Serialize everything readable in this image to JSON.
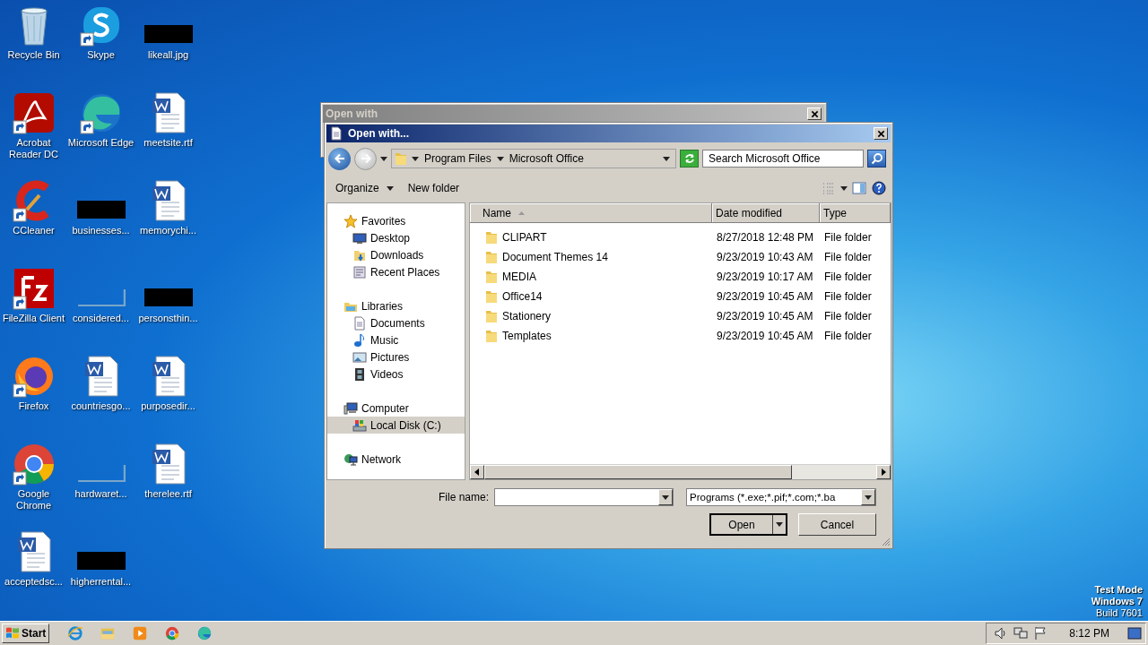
{
  "desktop_icons": [
    {
      "label": "Recycle Bin",
      "kind": "recycle",
      "shortcut": false
    },
    {
      "label": "Acrobat Reader DC",
      "kind": "acrobat",
      "shortcut": true
    },
    {
      "label": "CCleaner",
      "kind": "ccleaner",
      "shortcut": true
    },
    {
      "label": "FileZilla Client",
      "kind": "filezilla",
      "shortcut": true
    },
    {
      "label": "Firefox",
      "kind": "firefox",
      "shortcut": true
    },
    {
      "label": "Google Chrome",
      "kind": "chrome",
      "shortcut": true
    },
    {
      "label": "acceptedsc...",
      "kind": "word",
      "shortcut": false
    },
    {
      "label": "Skype",
      "kind": "skype",
      "shortcut": true
    },
    {
      "label": "Microsoft Edge",
      "kind": "edge",
      "shortcut": true
    },
    {
      "label": "businesses...",
      "kind": "redacted"
    },
    {
      "label": "considered...",
      "kind": "blank"
    },
    {
      "label": "countriesgo...",
      "kind": "word",
      "shortcut": false
    },
    {
      "label": "hardwaret...",
      "kind": "blank"
    },
    {
      "label": "higherrental...",
      "kind": "redacted"
    },
    {
      "label": "likeall.jpg",
      "kind": "redacted"
    },
    {
      "label": "meetsite.rtf",
      "kind": "word",
      "shortcut": false
    },
    {
      "label": "memorychi...",
      "kind": "word",
      "shortcut": false
    },
    {
      "label": "personsthin...",
      "kind": "redacted"
    },
    {
      "label": "purposedir...",
      "kind": "word",
      "shortcut": false
    },
    {
      "label": "therelee.rtf",
      "kind": "word",
      "shortcut": false
    }
  ],
  "desktop_notice": [
    "Test Mode",
    "Windows 7",
    "Build 7601"
  ],
  "back_window": {
    "title": "Open with"
  },
  "dialog": {
    "title": "Open with...",
    "breadcrumb": [
      "Program Files",
      "Microsoft Office"
    ],
    "search": {
      "placeholder": "Search Microsoft Office"
    },
    "toolbar": [
      "Organize",
      "New folder"
    ],
    "nav": [
      {
        "label": "Favorites",
        "kind": "star",
        "selected": false,
        "children": [
          {
            "label": "Desktop",
            "kind": "desktop",
            "selected": false
          },
          {
            "label": "Downloads",
            "kind": "downloads",
            "selected": false
          },
          {
            "label": "Recent Places",
            "kind": "recent",
            "selected": false
          }
        ]
      },
      {
        "label": "Libraries",
        "kind": "library",
        "selected": false,
        "children": [
          {
            "label": "Documents",
            "kind": "documents",
            "selected": false
          },
          {
            "label": "Music",
            "kind": "music",
            "selected": false
          },
          {
            "label": "Pictures",
            "kind": "pictures",
            "selected": false
          },
          {
            "label": "Videos",
            "kind": "videos",
            "selected": false
          }
        ]
      },
      {
        "label": "Computer",
        "kind": "computer",
        "selected": false,
        "children": [
          {
            "label": "Local Disk (C:)",
            "kind": "drive",
            "selected": true
          }
        ]
      },
      {
        "label": "Network",
        "kind": "network",
        "selected": false
      }
    ],
    "columns": [
      {
        "label": "Name",
        "sorted": true
      },
      {
        "label": "Date modified",
        "sorted": false
      },
      {
        "label": "Type",
        "sorted": false
      }
    ],
    "rows": [
      {
        "name": "CLIPART",
        "date": "8/27/2018 12:48 PM",
        "type": "File folder"
      },
      {
        "name": "Document Themes 14",
        "date": "9/23/2019 10:43 AM",
        "type": "File folder"
      },
      {
        "name": "MEDIA",
        "date": "9/23/2019 10:17 AM",
        "type": "File folder"
      },
      {
        "name": "Office14",
        "date": "9/23/2019 10:45 AM",
        "type": "File folder"
      },
      {
        "name": "Stationery",
        "date": "9/23/2019 10:45 AM",
        "type": "File folder"
      },
      {
        "name": "Templates",
        "date": "9/23/2019 10:45 AM",
        "type": "File folder"
      }
    ],
    "file_name_label": "File name:",
    "file_type": "Programs (*.exe;*.pif;*.com;*.ba",
    "buttons": [
      {
        "label": "Open",
        "kind": "split"
      },
      {
        "label": "Cancel",
        "kind": "plain"
      }
    ]
  },
  "taskbar": {
    "start": "Start",
    "apps": [
      {
        "kind": "ie"
      },
      {
        "kind": "explorer"
      },
      {
        "kind": "media"
      },
      {
        "kind": "chrome"
      },
      {
        "kind": "edge"
      }
    ],
    "tray": [
      {
        "kind": "speaker"
      },
      {
        "kind": "network"
      },
      {
        "kind": "flag"
      }
    ],
    "clock": "8:12 PM"
  }
}
